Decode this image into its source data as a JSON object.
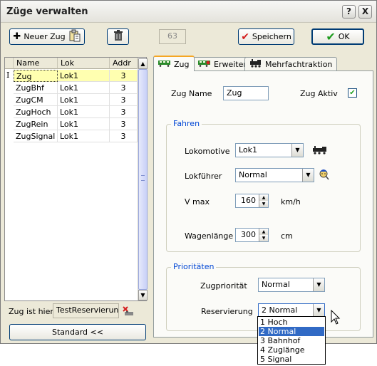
{
  "window": {
    "title": "Züge verwalten",
    "help_label": "?",
    "close_label": "X"
  },
  "toolbar": {
    "new_train_label": "Neuer Zug",
    "counter_value": "63",
    "save_label": "Speichern",
    "ok_label": "OK"
  },
  "train_list": {
    "columns": [
      "Name",
      "Lok",
      "Addr"
    ],
    "cursor_marker": "I",
    "rows": [
      {
        "name": "Zug",
        "lok": "Lok1",
        "addr": "3"
      },
      {
        "name": "ZugBhf",
        "lok": "Lok1",
        "addr": "3"
      },
      {
        "name": "ZugCM",
        "lok": "Lok1",
        "addr": "3"
      },
      {
        "name": "ZugHoch",
        "lok": "Lok1",
        "addr": "3"
      },
      {
        "name": "ZugRein",
        "lok": "Lok1",
        "addr": "3"
      },
      {
        "name": "ZugSignal",
        "lok": "Lok1",
        "addr": "3"
      }
    ],
    "selected_index": 0
  },
  "location": {
    "label": "Zug ist hier",
    "value": "TestReservierung"
  },
  "standard_button_label": "Standard <<",
  "tabs": [
    {
      "label": "Zug",
      "active": true
    },
    {
      "label": "Erweitert",
      "active": false
    },
    {
      "label": "Mehrfachtraktion",
      "active": false
    }
  ],
  "zug_tab": {
    "name_label": "Zug Name",
    "name_value": "Zug",
    "active_label": "Zug Aktiv",
    "active_checked": true,
    "check_mark": "✔"
  },
  "fahren": {
    "title": "Fahren",
    "lokomotive_label": "Lokomotive",
    "lokomotive_value": "Lok1",
    "lokfuehrer_label": "Lokführer",
    "lokfuehrer_value": "Normal",
    "vmax_label": "V max",
    "vmax_value": "160",
    "vmax_unit": "km/h",
    "wagenlaenge_label": "Wagenlänge",
    "wagenlaenge_value": "300",
    "wagenlaenge_unit": "cm"
  },
  "prioritaeten": {
    "title": "Prioritäten",
    "zugprioritaet_label": "Zugpriorität",
    "zugprioritaet_value": "Normal",
    "reservierung_label": "Reservierung",
    "reservierung_value": "2 Normal",
    "options": [
      "1 Hoch",
      "2 Normal",
      "3 Bahnhof",
      "4 Zuglänge",
      "5 Signal"
    ],
    "highlighted_option": 1
  },
  "colors": {
    "accent": "#003c74",
    "selection": "#316ac5",
    "group_title": "#0046d5",
    "selected_row": "#ffffb0",
    "ok_check": "#1e9b1e",
    "save_check": "#d42020"
  }
}
